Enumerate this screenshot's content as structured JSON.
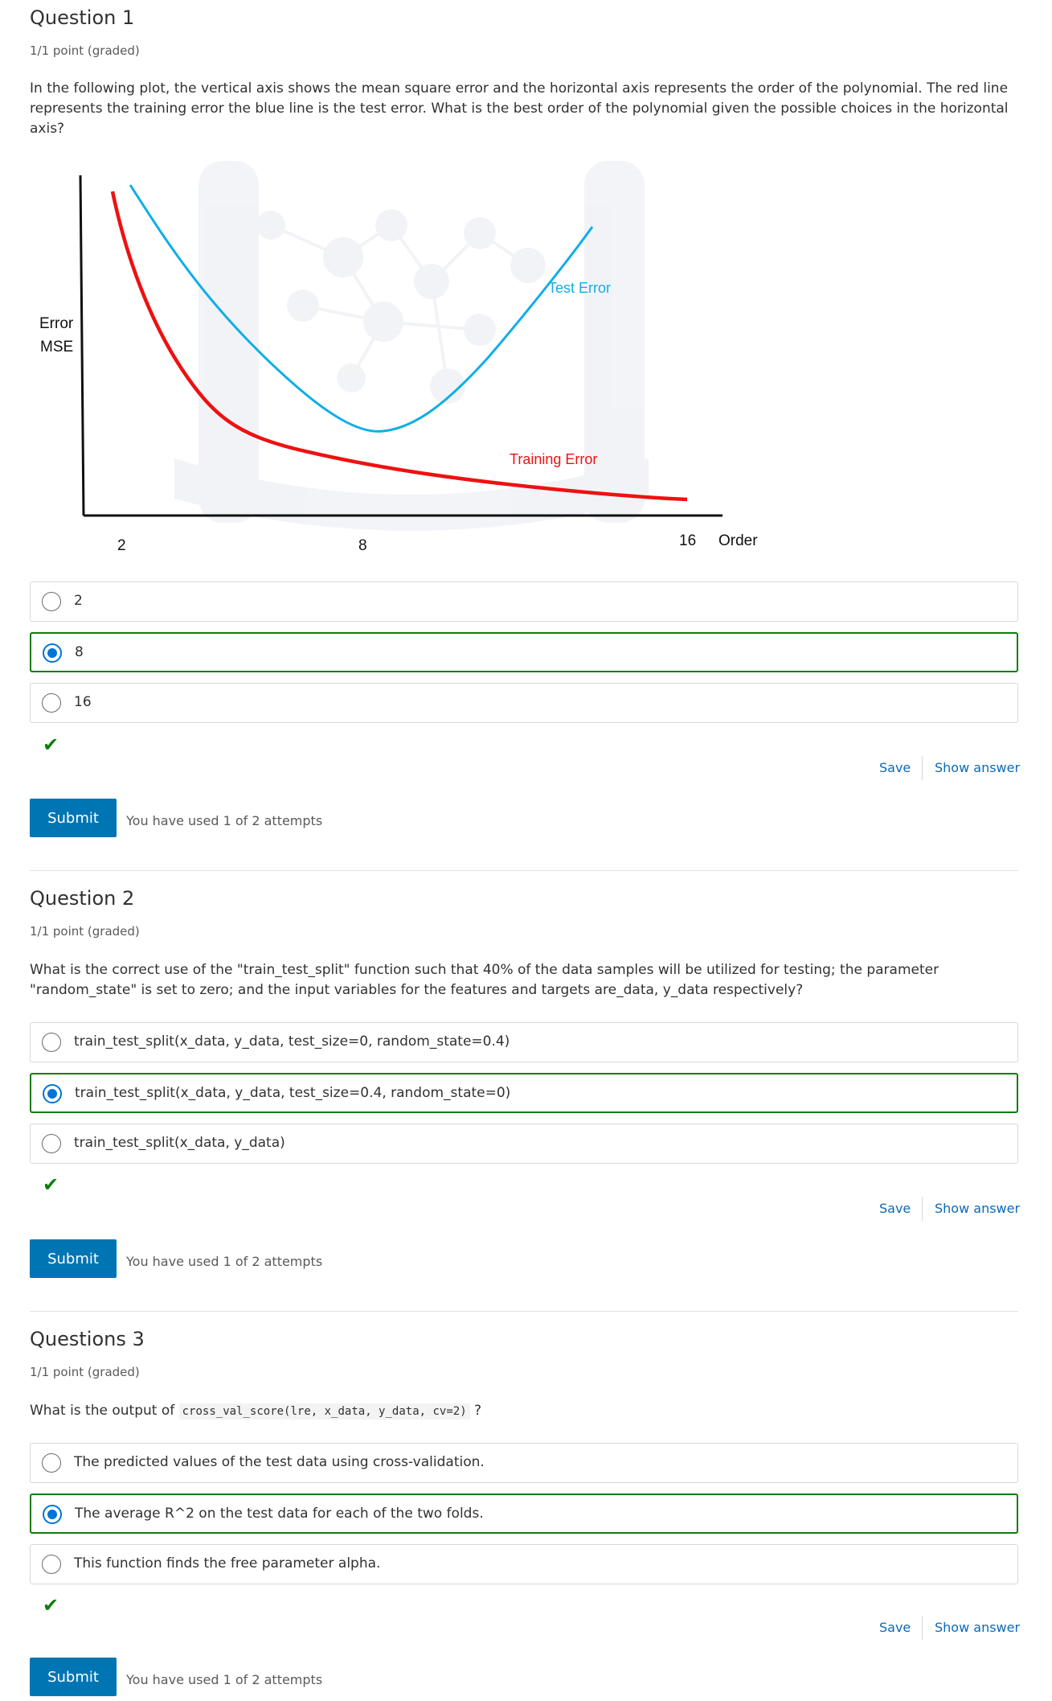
{
  "q1": {
    "title": "Question 1",
    "points": "1/1 point (graded)",
    "prompt": "In the following plot, the vertical axis shows the mean square error and the horizontal axis represents the order of the polynomial. The red line represents the training error the blue line is the test error. What is the best order of the polynomial given the possible choices in the horizontal axis?",
    "plot": {
      "ylabel_line1": "Error",
      "ylabel_line2": "MSE",
      "xlabel": "Order",
      "xticks": [
        "2",
        "8",
        "16"
      ],
      "test_label": "Test Error",
      "train_label": "Training Error",
      "test_color": "#10aee8",
      "train_color": "#ee1111"
    },
    "options": [
      {
        "label": "2",
        "selected": false
      },
      {
        "label": "8",
        "selected": true
      },
      {
        "label": "16",
        "selected": false
      }
    ],
    "save": "Save",
    "show_answer": "Show answer",
    "submit": "Submit",
    "attempts": "You have used 1 of 2 attempts"
  },
  "q2": {
    "title": "Question 2",
    "points": "1/1 point (graded)",
    "prompt": "What is the correct use of the \"train_test_split\" function such that 40% of the data samples will be utilized for testing; the parameter \"random_state\" is set to zero; and the input variables for the features and targets are_data, y_data respectively?",
    "options": [
      {
        "label": "train_test_split(x_data, y_data, test_size=0, random_state=0.4)",
        "selected": false
      },
      {
        "label": "train_test_split(x_data, y_data, test_size=0.4, random_state=0)",
        "selected": true
      },
      {
        "label": "train_test_split(x_data, y_data)",
        "selected": false
      }
    ],
    "save": "Save",
    "show_answer": "Show answer",
    "submit": "Submit",
    "attempts": "You have used 1 of 2 attempts"
  },
  "q3": {
    "title": "Questions 3",
    "points": "1/1 point (graded)",
    "prompt_prefix": "What is the output of",
    "prompt_code": "cross_val_score(lre, x_data, y_data, cv=2)",
    "prompt_suffix": "?",
    "options": [
      {
        "label": "The predicted values of the test data using cross-validation.",
        "selected": false
      },
      {
        "label": "The average R^2 on the test data for each of the two folds.",
        "selected": true
      },
      {
        "label": "This function finds the free parameter alpha.",
        "selected": false
      }
    ],
    "save": "Save",
    "show_answer": "Show answer",
    "submit": "Submit",
    "attempts": "You have used 1 of 2 attempts"
  },
  "status": {
    "check_icon": "checkmark-icon",
    "correct_color": "#0d7d0d",
    "accent_color": "#0075b4"
  }
}
